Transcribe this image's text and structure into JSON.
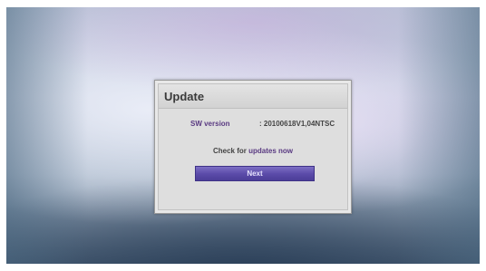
{
  "dialog": {
    "title": "Update",
    "sw_version_label": "SW version",
    "sw_version_value": ": 20100618V1,04NTSC",
    "check_prefix": "Check for",
    "check_accent": "updates now",
    "next_label": "Next"
  },
  "colors": {
    "accent_text": "#5a3a82",
    "button": "#5a4aa8"
  }
}
